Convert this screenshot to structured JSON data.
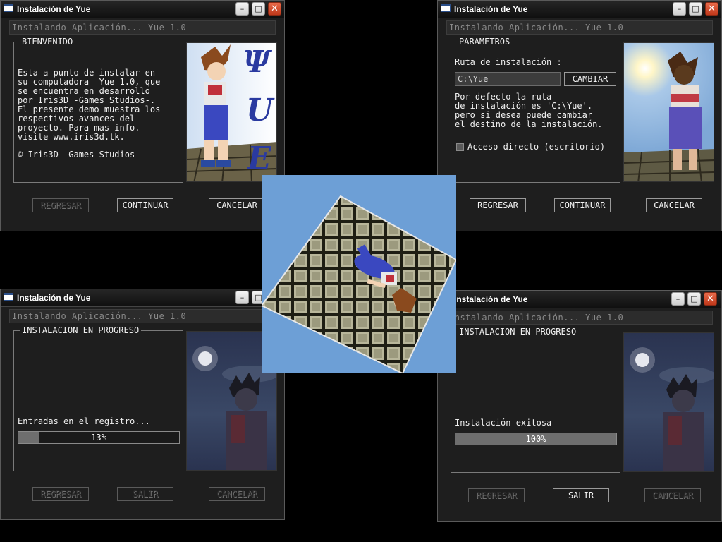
{
  "common": {
    "window_title": "Instalación de Yue",
    "banner": "Instalando Aplicación... Yue 1.0",
    "btn_back": "REGRESAR",
    "btn_continue": "CONTINUAR",
    "btn_cancel": "CANCELAR",
    "btn_exit": "SALIR",
    "minimize": "–",
    "maximize": "□",
    "close": "✕"
  },
  "win1": {
    "group_title": "BIENVENIDO",
    "body": "Esta a punto de instalar en\nsu computadora  Yue 1.0, que\nse encuentra en desarrollo\npor Iris3D -Games Studios-.\nEl presente demo muestra los\nrespectivos avances del\nproyecto. Para mas info.\nvisite www.iris3d.tk.",
    "copyright": "© Iris3D -Games Studios-",
    "logo_letters": [
      "Ψ",
      "U",
      "E"
    ]
  },
  "win2": {
    "group_title": "PARAMETROS",
    "path_label": "Ruta de instalación :",
    "path_value": "C:\\Yue",
    "change_button": "CAMBIAR",
    "body": "Por defecto la ruta\nde instalación es 'C:\\Yue'.\npero si desea puede cambiar\nel destino de la instalación.",
    "shortcut_label": "Acceso directo (escritorio)"
  },
  "win3": {
    "group_title": "INSTALACION EN PROGRESO",
    "status": "Entradas en el registro...",
    "progress_text": "13%",
    "progress_fraction": 0.13
  },
  "win4": {
    "group_title": "INSTALACION EN PROGRESO",
    "status": "Instalación exitosa",
    "progress_text": "100%",
    "progress_fraction": 1.0
  },
  "colors": {
    "sky": "#6d9fd6",
    "tile": "#b8b69a",
    "night_sky": "#1f2a44",
    "title_close": "#d44a2a"
  }
}
